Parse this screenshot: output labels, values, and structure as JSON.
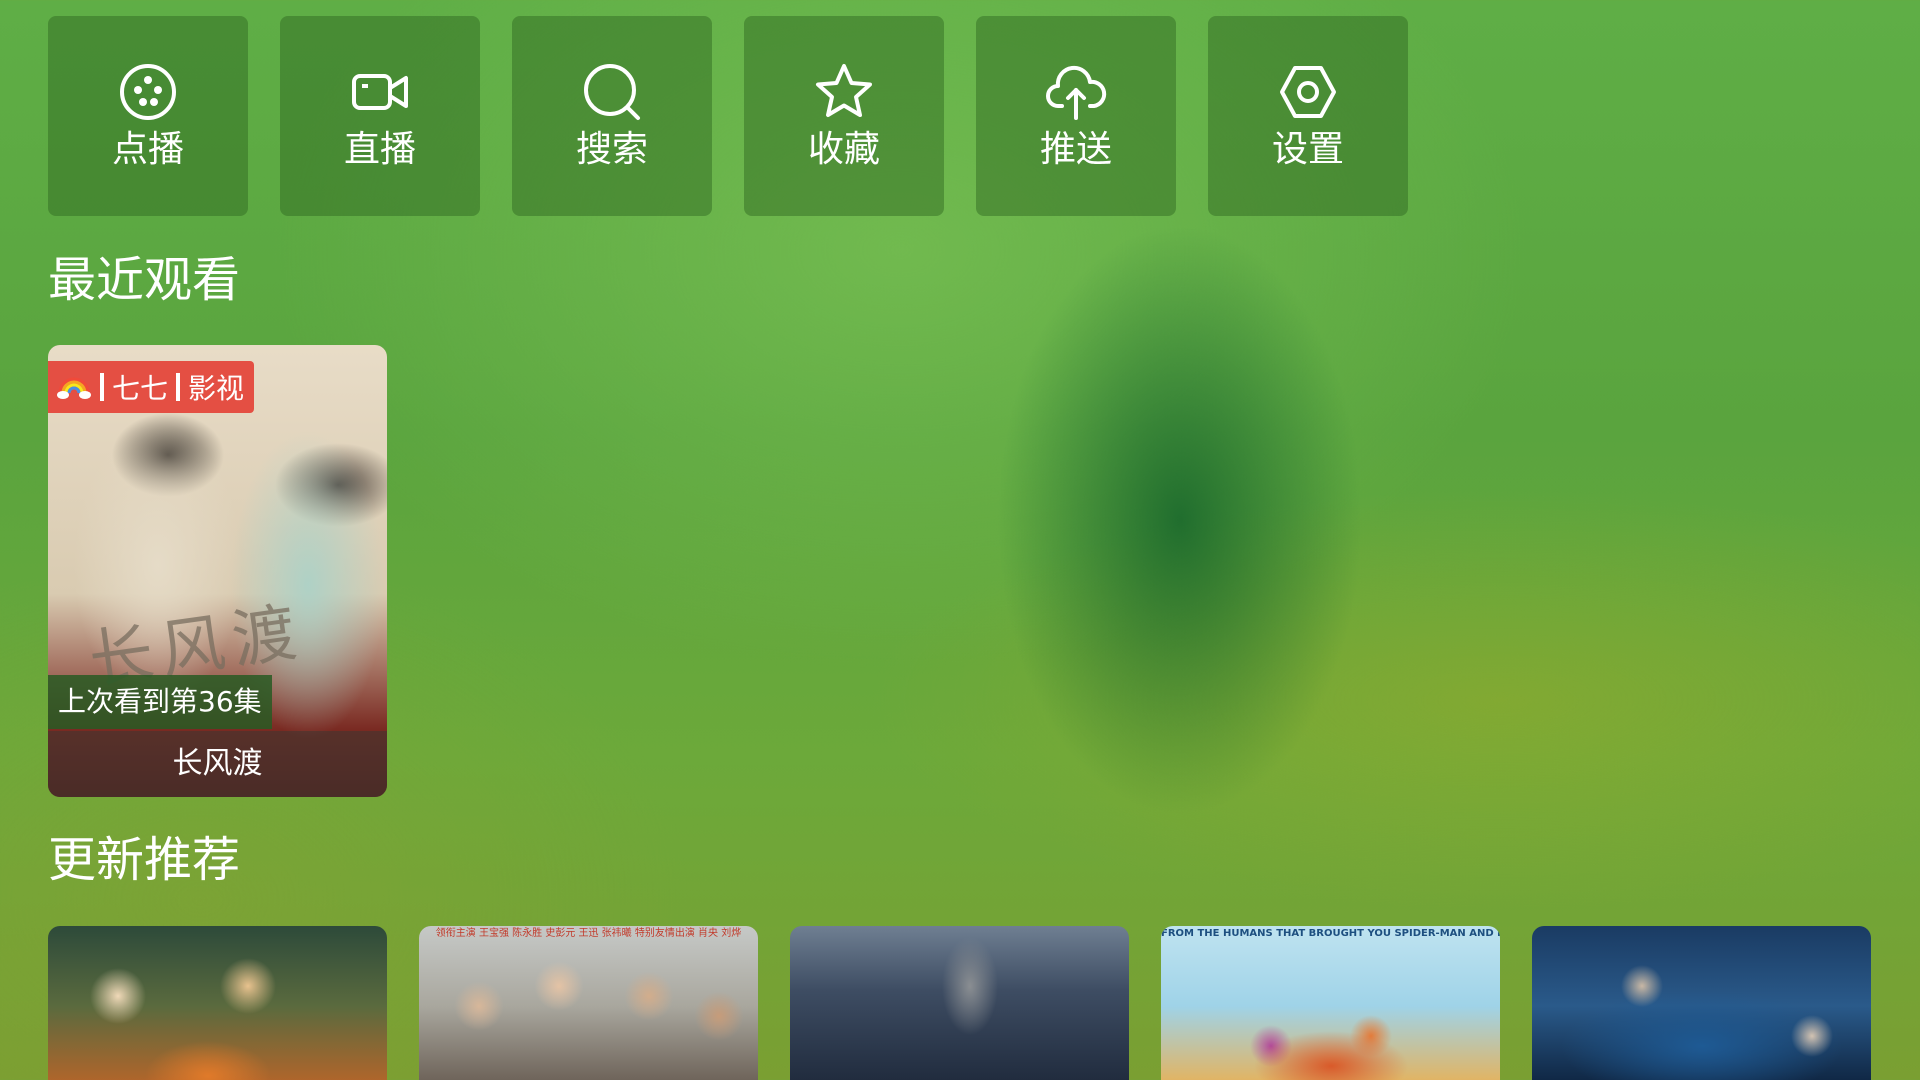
{
  "menu": {
    "items": [
      {
        "label": "点播",
        "icon": "film-reel-icon"
      },
      {
        "label": "直播",
        "icon": "video-camera-icon"
      },
      {
        "label": "搜索",
        "icon": "search-icon"
      },
      {
        "label": "收藏",
        "icon": "star-icon"
      },
      {
        "label": "推送",
        "icon": "cloud-upload-icon"
      },
      {
        "label": "设置",
        "icon": "settings-hexagon-icon"
      }
    ]
  },
  "recent": {
    "title": "最近观看",
    "items": [
      {
        "source_name": "七七",
        "source_suffix": "影视",
        "progress": "上次看到第36集",
        "name": "长风渡",
        "poster_title": "长风渡"
      }
    ]
  },
  "recommend": {
    "title": "更新推荐",
    "posters": [
      {
        "strip": ""
      },
      {
        "strip": "领衔主演 王宝强 陈永胜 史彭元 王迅 张祎曦 特别友情出演 肖央 刘烨"
      },
      {
        "strip": ""
      },
      {
        "strip": "FROM THE HUMANS THAT BROUGHT YOU SPIDER-MAN AND LEGO MOVIE"
      },
      {
        "strip": ""
      }
    ]
  },
  "colors": {
    "background_green": "#5fae46",
    "tile_bg": "rgba(45,100,30,0.45)",
    "source_badge_red": "#e4483c",
    "progress_badge_green": "#285a23"
  }
}
